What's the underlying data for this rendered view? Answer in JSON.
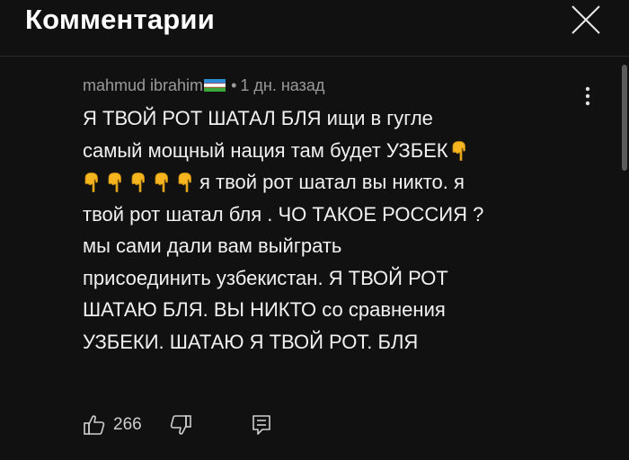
{
  "header": {
    "title": "Комментарии"
  },
  "comment": {
    "author": "mahmud ibrahim",
    "separator": "•",
    "time": "1 дн. назад",
    "lines": [
      {
        "text": "Я ТВОЙ РОТ ШАТАЛ БЛЯ ищи в гугле",
        "hands": 0
      },
      {
        "text": "самый мощный нация там будет УЗБЕК",
        "hands_after": 1
      },
      {
        "text": "я твой рот шатал вы никто. я",
        "hands": 5
      },
      {
        "text": "твой рот шатал бля . ЧО ТАКОЕ РОССИЯ ?",
        "hands": 0
      },
      {
        "text": "мы сами дали вам выйграть",
        "hands": 0
      },
      {
        "text": "присоединить узбекистан. Я ТВОЙ РОТ",
        "hands": 0
      },
      {
        "text": "ШАТАЮ БЛЯ. ВЫ НИКТО со сравнения",
        "hands": 0
      },
      {
        "text": "УЗБЕКИ. ШАТАЮ Я ТВОЙ РОТ. БЛЯ",
        "hands": 0
      }
    ],
    "emoji": "backhand-index-pointing-down",
    "flag": "uzbekistan-flag"
  },
  "actions": {
    "like_count": "266"
  },
  "colors": {
    "background": "#111111",
    "text": "#f1f1f1",
    "meta": "#9a9a9a",
    "emoji_yellow": "#f6b51e"
  }
}
